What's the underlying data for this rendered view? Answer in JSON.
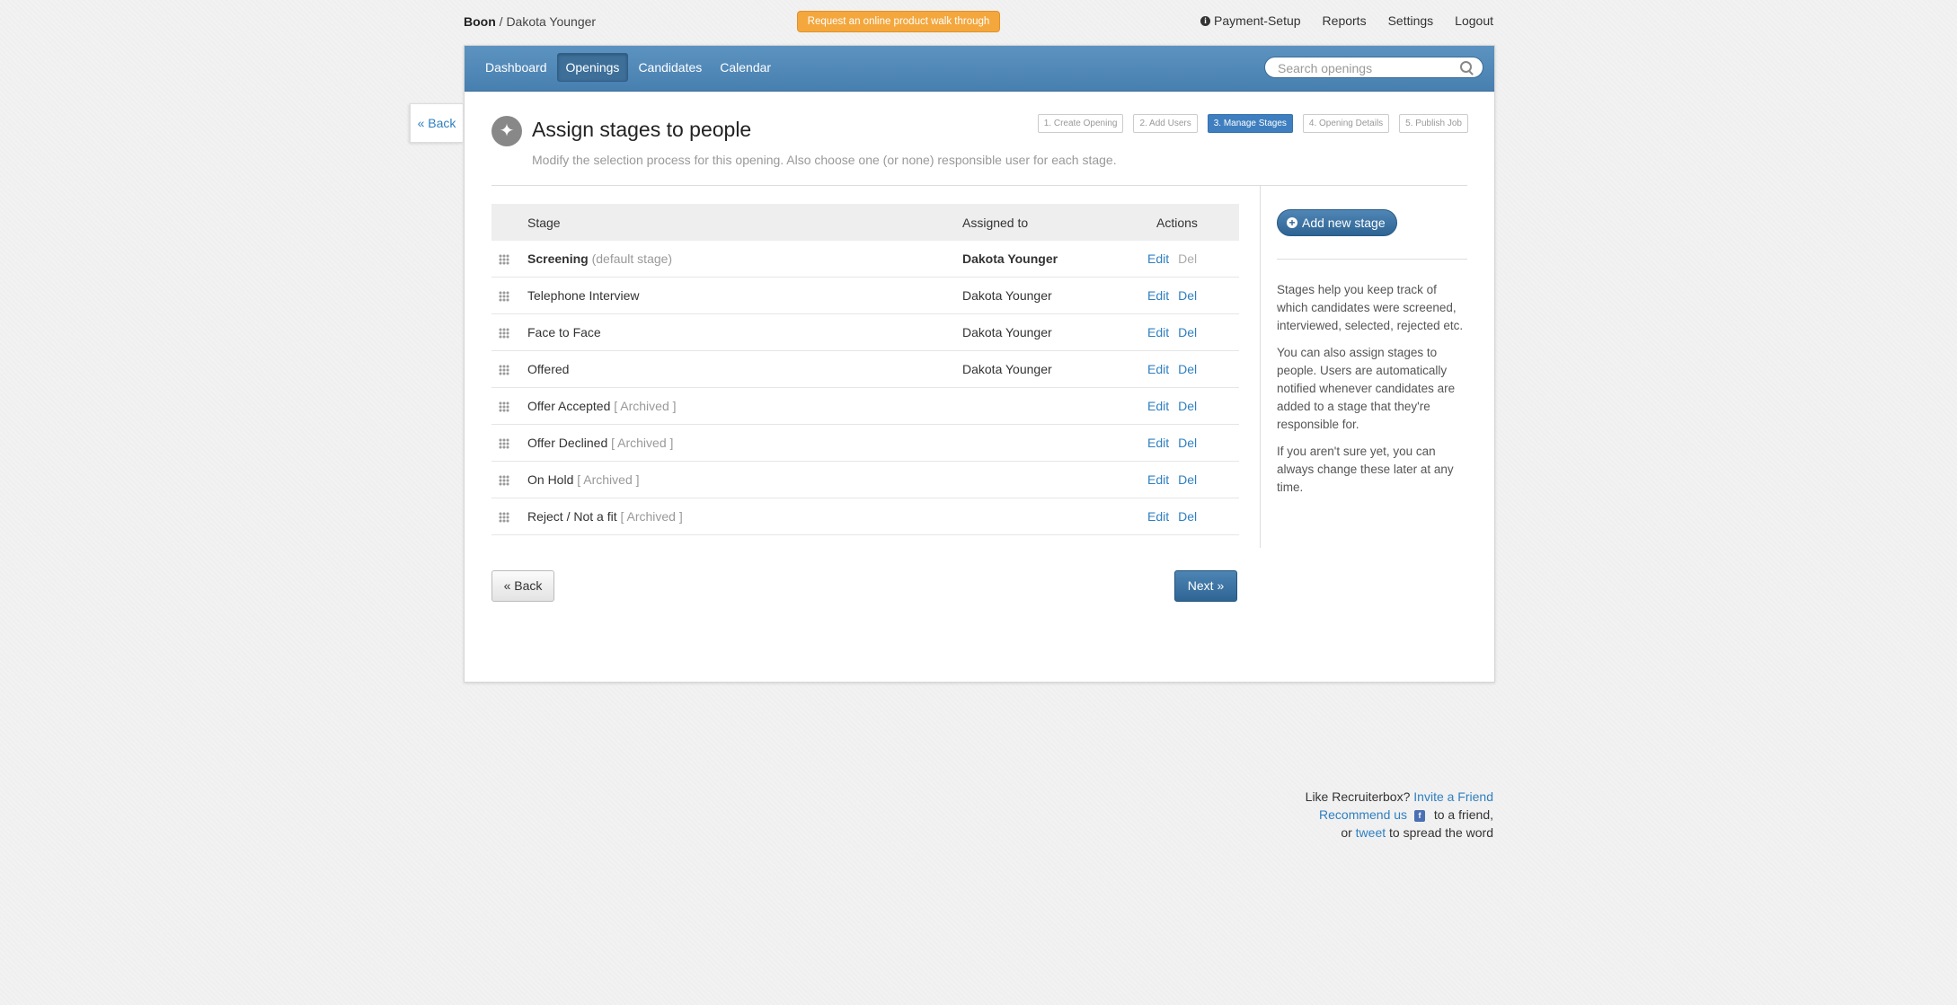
{
  "breadcrumb": {
    "company": "Boon",
    "separator": "/",
    "user": "Dakota Younger"
  },
  "walkthrough_label": "Request an online product walk through",
  "topnav": {
    "payment": "Payment-Setup",
    "reports": "Reports",
    "settings": "Settings",
    "logout": "Logout"
  },
  "side_back_label": "« Back",
  "navbar": {
    "tabs": [
      {
        "label": "Dashboard",
        "active": false
      },
      {
        "label": "Openings",
        "active": true
      },
      {
        "label": "Candidates",
        "active": false
      },
      {
        "label": "Calendar",
        "active": false
      }
    ],
    "search_placeholder": "Search openings"
  },
  "page": {
    "title": "Assign stages to people",
    "subtitle": "Modify the selection process for this opening. Also choose one (or none) responsible user for each stage."
  },
  "steps": [
    {
      "label": "1. Create Opening",
      "active": false
    },
    {
      "label": "2. Add Users",
      "active": false
    },
    {
      "label": "3. Manage Stages",
      "active": true
    },
    {
      "label": "4. Opening Details",
      "active": false
    },
    {
      "label": "5. Publish Job",
      "active": false
    }
  ],
  "table": {
    "headers": {
      "stage": "Stage",
      "assigned": "Assigned to",
      "actions": "Actions"
    },
    "edit_label": "Edit",
    "del_label": "Del",
    "rows": [
      {
        "name": "Screening",
        "note": "(default stage)",
        "assigned": "Dakota Younger"
      },
      {
        "name": "Telephone Interview",
        "note": "",
        "assigned": "Dakota Younger"
      },
      {
        "name": "Face to Face",
        "note": "",
        "assigned": "Dakota Younger"
      },
      {
        "name": "Offered",
        "note": "",
        "assigned": "Dakota Younger"
      },
      {
        "name": "Offer Accepted",
        "note": "[ Archived ]",
        "assigned": ""
      },
      {
        "name": "Offer Declined",
        "note": "[ Archived ]",
        "assigned": ""
      },
      {
        "name": "On Hold",
        "note": "[ Archived ]",
        "assigned": ""
      },
      {
        "name": "Reject / Not a fit",
        "note": "[ Archived ]",
        "assigned": ""
      }
    ]
  },
  "buttons": {
    "back": "« Back",
    "next": "Next »"
  },
  "sidebar": {
    "add_stage": "Add new stage",
    "help": [
      "Stages help you keep track of which candidates were screened, interviewed, selected, rejected etc.",
      "You can also assign stages to people. Users are automatically notified whenever candidates are added to a stage that they're responsible for.",
      "If you aren't sure yet, you can always change these later at any time."
    ]
  },
  "footer": {
    "line1_text": "Like Recruiterbox?",
    "line1_link": "Invite a Friend",
    "line2_link": "Recommend us",
    "line2_text": "to a friend,",
    "line3_prefix": "or",
    "line3_link": "tweet",
    "line3_text": "to spread the word"
  },
  "colors": {
    "accent": "#477fb0",
    "cta": "#f4a73d",
    "link": "#2f7fc0"
  },
  "icons": {
    "info": "info-icon",
    "search": "search-icon",
    "pin": "pin-icon",
    "handle": "drag-handle-icon",
    "plus": "plus-circle-icon",
    "facebook": "facebook-icon"
  }
}
